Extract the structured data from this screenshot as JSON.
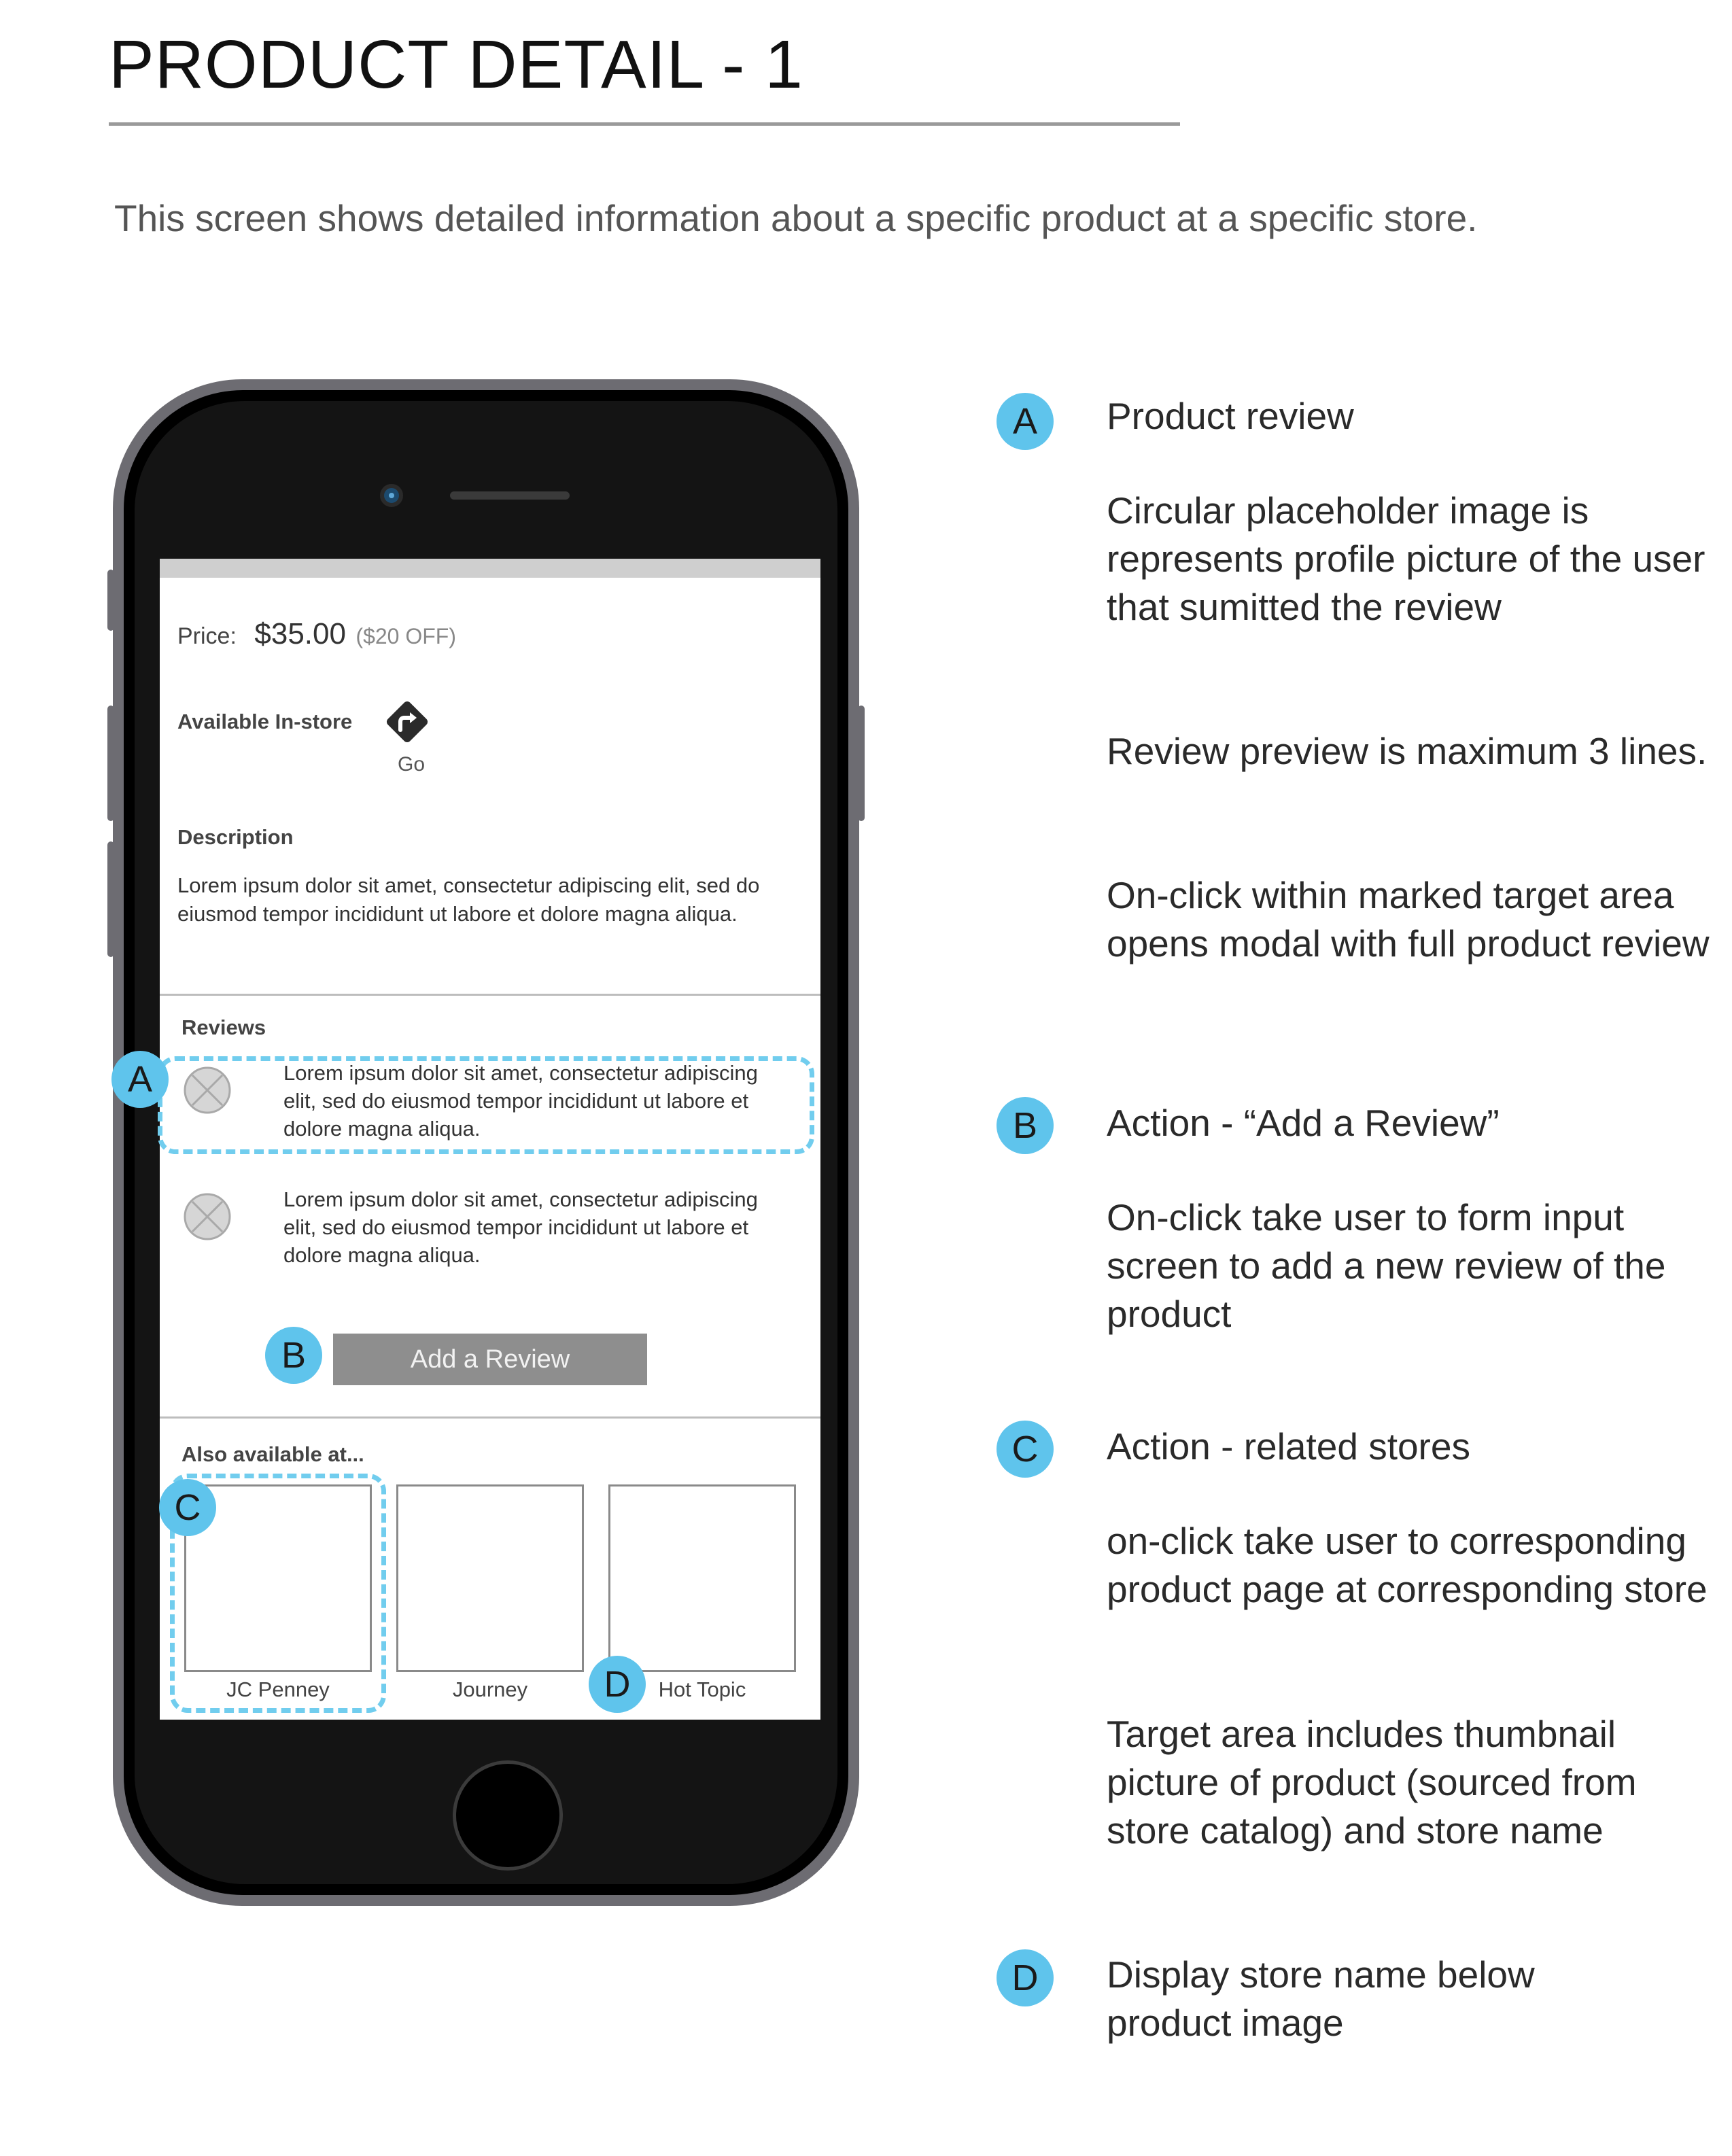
{
  "title": "PRODUCT DETAIL - 1",
  "subtitle": "This screen shows detailed information about a specific product at a specific store.",
  "colors": {
    "accent": "#5fc4ec",
    "button": "#8e8e8e",
    "phone_frame": "#6d6c72"
  },
  "screen": {
    "price_label": "Price:",
    "price_value": "$35.00",
    "price_discount": "($20 OFF)",
    "available_label": "Available In-store",
    "go_label": "Go",
    "description_heading": "Description",
    "description_text": "Lorem ipsum dolor sit amet, consectetur adipiscing elit, sed do eiusmod tempor incididunt ut labore et dolore magna aliqua.",
    "reviews_heading": "Reviews",
    "reviews": [
      {
        "text": "Lorem ipsum dolor sit amet, consectetur adipiscing elit, sed do eiusmod tempor incididunt ut labore et dolore magna aliqua."
      },
      {
        "text": "Lorem ipsum dolor sit amet, consectetur adipiscing elit, sed do eiusmod tempor incididunt ut labore et dolore magna aliqua."
      }
    ],
    "add_review_label": "Add a Review",
    "also_available_heading": "Also available at...",
    "stores": [
      {
        "name": "JC Penney"
      },
      {
        "name": "Journey"
      },
      {
        "name": "Hot Topic"
      }
    ]
  },
  "badges": {
    "a": "A",
    "b": "B",
    "c": "C",
    "d": "D"
  },
  "annotations": [
    {
      "badge": "A",
      "heading": "Product review",
      "paragraphs": [
        "Circular placeholder image is represents profile picture of the user that sumitted the review",
        "Review preview is maximum 3 lines.",
        "On-click within marked target area opens modal with full product review"
      ]
    },
    {
      "badge": "B",
      "heading": "Action - “Add a Review”",
      "paragraphs": [
        "On-click take user to form input screen to add a new review of the product"
      ]
    },
    {
      "badge": "C",
      "heading": "Action - related stores",
      "paragraphs": [
        "on-click take user to corresponding product page at corresponding store",
        "Target area includes thumbnail picture of product (sourced from store catalog) and store name"
      ]
    },
    {
      "badge": "D",
      "heading": "Display store name below product image",
      "paragraphs": []
    }
  ]
}
